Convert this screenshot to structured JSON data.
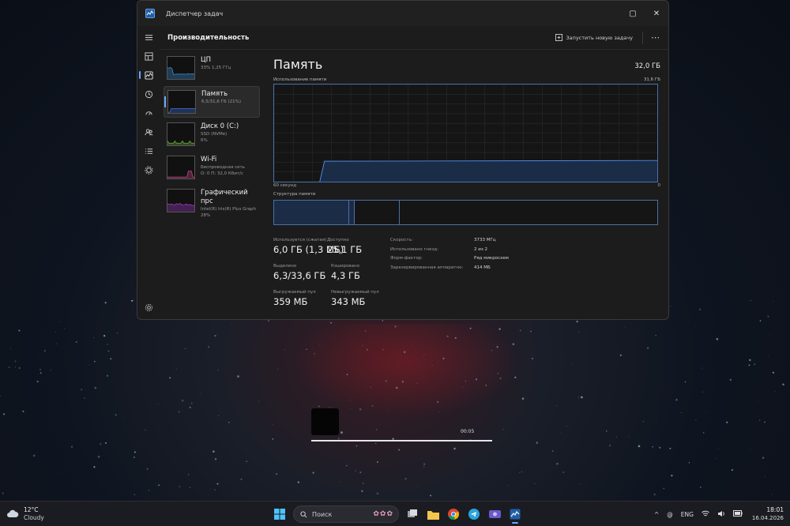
{
  "window": {
    "title": "Диспетчер задач",
    "maximize_glyph": "▢",
    "close_glyph": "✕"
  },
  "header": {
    "title": "Производительность",
    "run_task_label": "Запустить новую задачу",
    "more_glyph": "⋯"
  },
  "nav": [
    "hamburger-icon",
    "processes-icon",
    "performance-icon",
    "app-history-icon",
    "startup-icon",
    "users-icon",
    "details-icon",
    "services-icon",
    "settings-icon"
  ],
  "perf_items": [
    {
      "name": "ЦП",
      "sub1": "33% 1,25 ГГц",
      "sub2": "",
      "color": "#3d8fd6",
      "selected": false
    },
    {
      "name": "Память",
      "sub1": "6,5/31,6 ГБ (21%)",
      "sub2": "",
      "color": "#3d6fd6",
      "selected": true
    },
    {
      "name": "Диск 0 (C:)",
      "sub1": "SSD (NVMe)",
      "sub2": "6%",
      "color": "#6cb33f",
      "selected": false
    },
    {
      "name": "Wi-Fi",
      "sub1": "Беспроводная сеть",
      "sub2": "О: 0 П: 32,0 Кбит/с",
      "color": "#c0498a",
      "selected": false
    },
    {
      "name": "Графический прс",
      "sub1": "Intel(R) Iris(R) Plus Graph",
      "sub2": "28%",
      "color": "#a040c8",
      "selected": false
    }
  ],
  "memory": {
    "title": "Память",
    "total": "32,0 ГБ",
    "graph_label": "Использование памяти",
    "graph_max": "31,6 ГБ",
    "graph_time": "60 секунд",
    "graph_zero": "0",
    "structure_label": "Структура памяти",
    "usage_fraction": 0.21,
    "stats": {
      "in_use_label": "Используется (сжатая)",
      "in_use": "6,0 ГБ (1,3 МБ)",
      "available_label": "Доступно",
      "available": "25,1 ГБ",
      "committed_label": "Выделено",
      "committed": "6,3/33,6 ГБ",
      "cached_label": "Кэшировано",
      "cached": "4,3 ГБ",
      "paged_label": "Выгружаемый пул",
      "paged": "359 МБ",
      "nonpaged_label": "Невыгружаемый пул",
      "nonpaged": "343 МБ"
    },
    "props": [
      {
        "k": "Скорость:",
        "v": "3733 МГц"
      },
      {
        "k": "Использовано гнезд:",
        "v": "2 из 2"
      },
      {
        "k": "Форм-фактор:",
        "v": "Ряд микросхем"
      },
      {
        "k": "Зарезервированная аппаратно:",
        "v": "414 МБ"
      }
    ]
  },
  "media": {
    "time": "00:05",
    "progress": 1.0
  },
  "taskbar": {
    "temp": "12°C",
    "condition": "Cloudy",
    "search_placeholder": "Поиск",
    "lang": "ENG",
    "time": "18:01",
    "date": "16.04.2026",
    "chevron": "^",
    "at_glyph": "@"
  }
}
